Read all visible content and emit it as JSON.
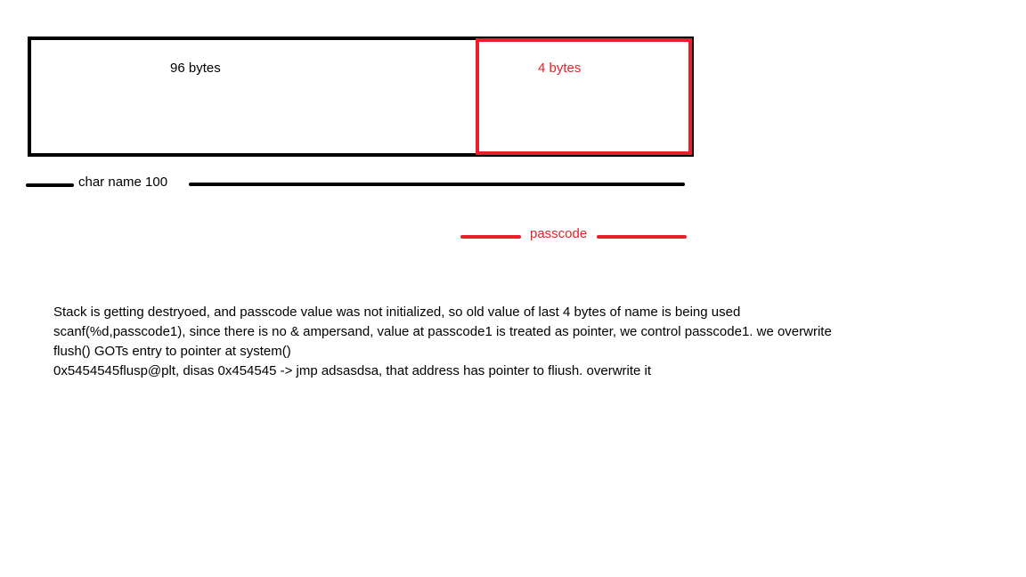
{
  "diagram": {
    "left_block_label": "96 bytes",
    "right_block_label": "4 bytes",
    "name_brace_label": "char name 100",
    "passcode_brace_label": "passcode"
  },
  "notes": {
    "lines": [
      "Stack is getting destryoed, and passcode value was not initialized, so old value of last 4 bytes of name is being used",
      "scanf(%d,passcode1), since there is no & ampersand, value at passcode1 is treated as pointer, we control passcode1. we overwrite",
      "flush() GOTs entry to pointer at system()",
      "0x5454545flusp@plt, disas 0x454545  -> jmp adsasdsa, that address has pointer to fliush. overwrite it"
    ]
  },
  "colors": {
    "black": "#000000",
    "red": "#e8202a",
    "background": "#ffffff"
  }
}
